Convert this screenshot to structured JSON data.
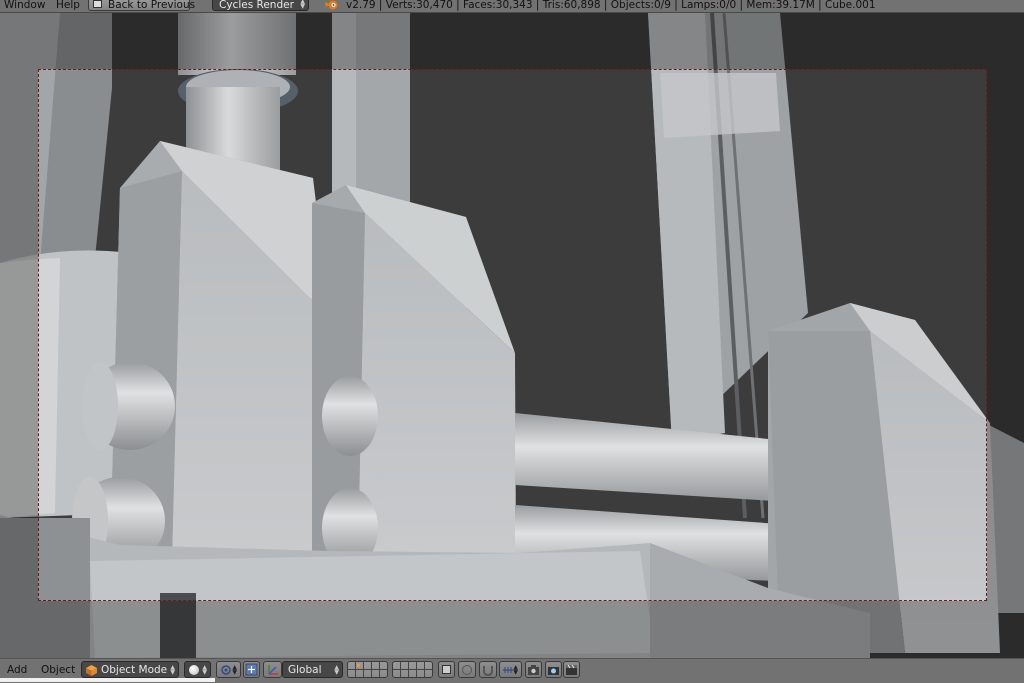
{
  "top_bar": {
    "menus": [
      "Window",
      "Help"
    ],
    "back_button": "Back to Previous",
    "render_engine": "Cycles Render",
    "stats": "v2.79 | Verts:30,470 | Faces:30,343 | Tris:60,898 | Objects:0/9 | Lamps:0/0 | Mem:39.17M | Cube.001"
  },
  "bottom_bar": {
    "menus": [
      "Add",
      "Object"
    ],
    "mode": "Object Mode",
    "orientation": "Global"
  },
  "colors": {
    "header_bg": "#727272",
    "dropdown_bg": "#474747",
    "camera_frame": "#6b1a1a",
    "viewport_bg": "#3a3a3a"
  },
  "icons": {
    "back": "back-arrow-icon",
    "blender": "blender-logo-icon",
    "mode": "cube-icon",
    "shading": "sphere-shading-icon",
    "pivot": "pivot-point-icon",
    "manipulator": "manipulator-icon",
    "orientation": "transform-orientation-icon",
    "render": "render-still-icon",
    "animation": "render-animation-icon"
  }
}
